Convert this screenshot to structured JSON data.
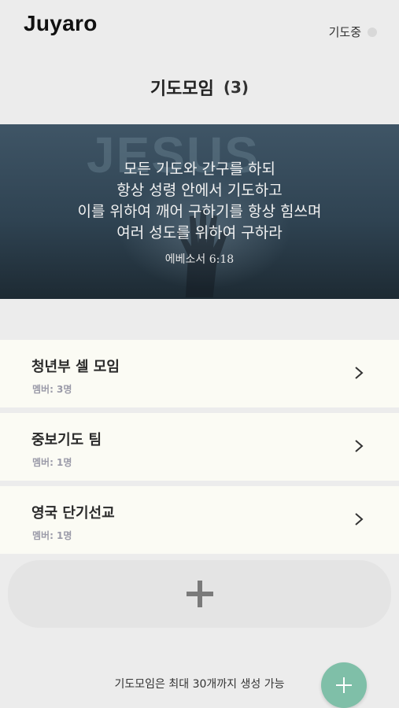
{
  "app": {
    "title": "Juyaro"
  },
  "status": {
    "label": "기도중",
    "dot_color": "#d8d8d8"
  },
  "page": {
    "title": "기도모임",
    "count": "(3)"
  },
  "banner": {
    "background_text": "JESUS",
    "verse_lines": [
      "모든 기도와 간구를 하되",
      "항상 성령 안에서 기도하고",
      "이를 위하여 깨어 구하기를 항상 힘쓰며",
      "여러 성도를 위하여 구하라"
    ],
    "reference": "에베소서 6:18"
  },
  "groups": [
    {
      "name": "청년부 셀 모임",
      "members": "멤버: 3명"
    },
    {
      "name": "중보기도 팀",
      "members": "멤버: 1명"
    },
    {
      "name": "영국 단기선교",
      "members": "멤버: 1명"
    }
  ],
  "add_card": {
    "icon": "plus-icon"
  },
  "footer": {
    "note": "기도모임은 최대 30개까지 생성 가능"
  },
  "fab": {
    "icon": "plus-icon",
    "color": "#7fbfa8"
  }
}
